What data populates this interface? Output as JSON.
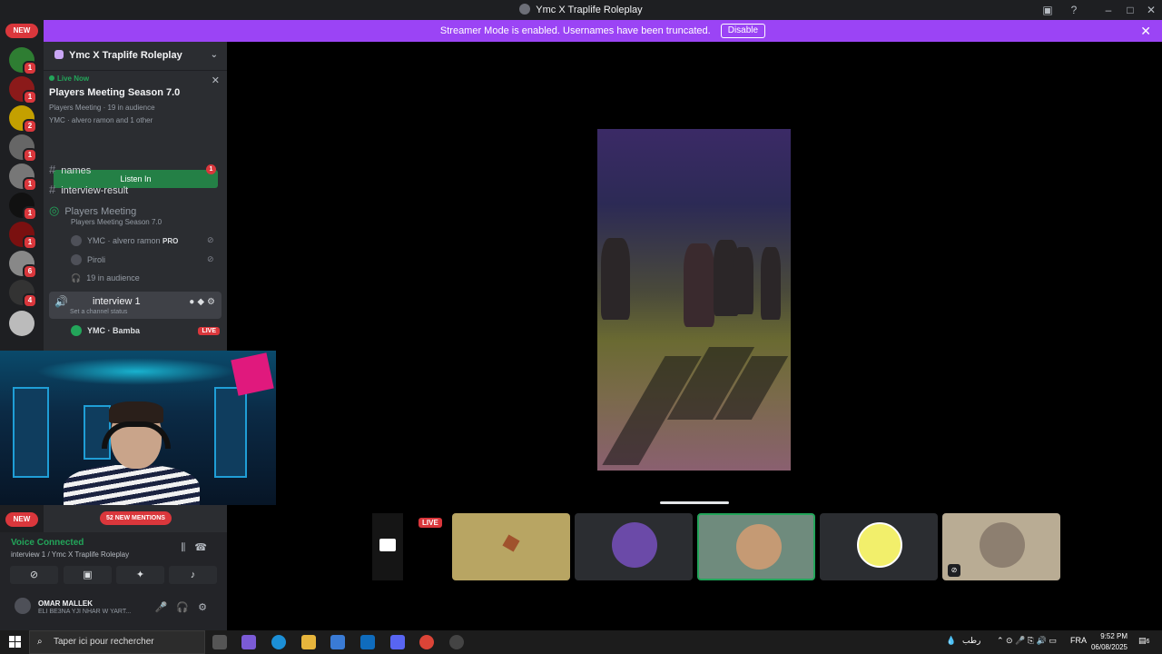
{
  "window": {
    "title": "Ymc X Traplife Roleplay"
  },
  "banner": {
    "text": "Streamer Mode is enabled. Usernames have been truncated.",
    "disable_label": "Disable"
  },
  "rail": {
    "new_label": "NEW",
    "servers": [
      {
        "badge": "1",
        "color": "#2e7d32"
      },
      {
        "badge": "1",
        "color": "#8b1a1a"
      },
      {
        "badge": "2",
        "color": "#c4a000"
      },
      {
        "badge": "1",
        "color": "#666666"
      },
      {
        "badge": "1",
        "color": "#777777"
      },
      {
        "badge": "1",
        "color": "#111111"
      },
      {
        "badge": "1",
        "color": "#7a1010"
      },
      {
        "badge": "6",
        "color": "#888888"
      },
      {
        "badge": "4",
        "color": "#333333"
      },
      {
        "badge": "",
        "color": "#bbbbbb"
      }
    ]
  },
  "sidebar": {
    "server_name": "Ymc X Traplife Roleplay",
    "live": {
      "status": "Live Now",
      "title": "Players Meeting Season 7.0",
      "meta1": "Players Meeting · 19 in audience",
      "meta2": "YMC · alvero ramon and 1 other",
      "listen_label": "Listen In"
    },
    "channels": [
      {
        "name": "names",
        "badge": "1"
      },
      {
        "name": "interview-result",
        "badge": ""
      }
    ],
    "stage": {
      "name": "Players Meeting",
      "topic": "Players Meeting Season 7.0",
      "members": [
        {
          "name": "YMC · alvero ramon",
          "tag": "PRO"
        },
        {
          "name": "Piroli",
          "tag": ""
        }
      ],
      "audience": "19 in audience"
    },
    "voice": {
      "name": "interview 1",
      "status": "Set a channel status",
      "members": [
        {
          "name": "YMC · Bamba",
          "live": "LIVE"
        }
      ]
    }
  },
  "bottom": {
    "new_label": "NEW",
    "mentions": "52 NEW MENTIONS",
    "voice_connected": "Voice Connected",
    "voice_sub": "interview 1 / Ymc X Traplife Roleplay",
    "user_name": "OMAR MALLEK",
    "user_status": "ELI BE3NA YJI NHAR W YART..."
  },
  "stage": {
    "live_label": "LIVE",
    "tiles": [
      {
        "color": "#b8a563"
      },
      {
        "color": "#2b2d31"
      },
      {
        "color": "#6f8b7d"
      },
      {
        "color": "#2b2d31"
      },
      {
        "color": "#b9ac94"
      }
    ]
  },
  "taskbar": {
    "search_placeholder": "Taper ici pour rechercher",
    "weather": "رطب",
    "lang": "FRA",
    "time": "9:52 PM",
    "date": "06/08/2025",
    "notif_count": "6"
  }
}
